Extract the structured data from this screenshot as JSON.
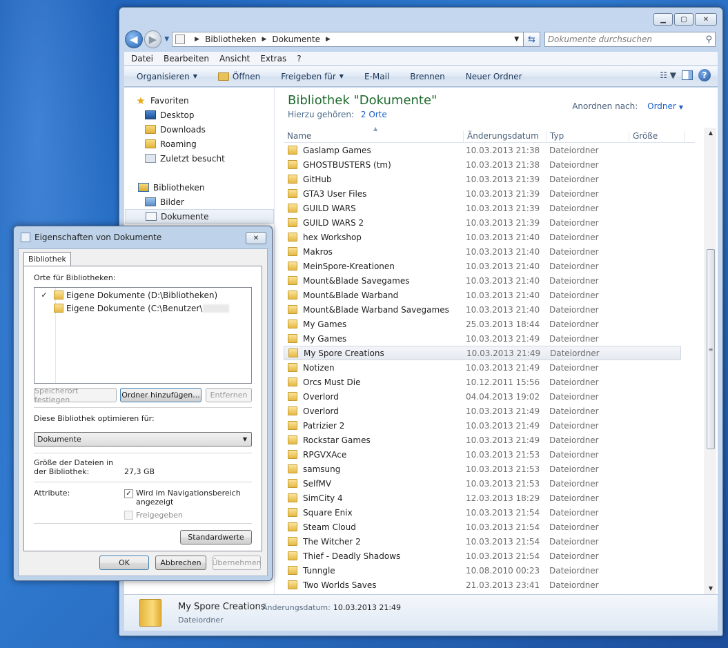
{
  "window": {
    "controls": {
      "minimize": "▁",
      "maximize": "▢",
      "close": "✕"
    },
    "breadcrumb": [
      "Bibliotheken",
      "Dokumente"
    ],
    "search_placeholder": "Dokumente durchsuchen",
    "menu": [
      "Datei",
      "Bearbeiten",
      "Ansicht",
      "Extras",
      "?"
    ],
    "toolbar": [
      "Organisieren",
      "Öffnen",
      "Freigeben für",
      "E-Mail",
      "Brennen",
      "Neuer Ordner"
    ]
  },
  "nav": {
    "favorites": "Favoriten",
    "fav_items": [
      "Desktop",
      "Downloads",
      "Roaming",
      "Zuletzt besucht"
    ],
    "libraries": "Bibliotheken",
    "lib_items": [
      "Bilder",
      "Dokumente"
    ]
  },
  "library": {
    "title": "Bibliothek \"Dokumente\"",
    "includes_label": "Hierzu gehören:",
    "includes_link": "2 Orte",
    "arrange_label": "Anordnen nach:",
    "arrange_value": "Ordner"
  },
  "columns": {
    "name": "Name",
    "date": "Änderungsdatum",
    "type": "Typ",
    "size": "Größe"
  },
  "files": [
    {
      "name": "Gaslamp Games",
      "date": "10.03.2013 21:38",
      "type": "Dateiordner"
    },
    {
      "name": "GHOSTBUSTERS (tm)",
      "date": "10.03.2013 21:38",
      "type": "Dateiordner"
    },
    {
      "name": "GitHub",
      "date": "10.03.2013 21:39",
      "type": "Dateiordner"
    },
    {
      "name": "GTA3 User Files",
      "date": "10.03.2013 21:39",
      "type": "Dateiordner"
    },
    {
      "name": "GUILD WARS",
      "date": "10.03.2013 21:39",
      "type": "Dateiordner"
    },
    {
      "name": "GUILD WARS 2",
      "date": "10.03.2013 21:39",
      "type": "Dateiordner"
    },
    {
      "name": "hex Workshop",
      "date": "10.03.2013 21:40",
      "type": "Dateiordner"
    },
    {
      "name": "Makros",
      "date": "10.03.2013 21:40",
      "type": "Dateiordner"
    },
    {
      "name": "MeinSpore-Kreationen",
      "date": "10.03.2013 21:40",
      "type": "Dateiordner"
    },
    {
      "name": "Mount&Blade Savegames",
      "date": "10.03.2013 21:40",
      "type": "Dateiordner"
    },
    {
      "name": "Mount&Blade Warband",
      "date": "10.03.2013 21:40",
      "type": "Dateiordner"
    },
    {
      "name": "Mount&Blade Warband Savegames",
      "date": "10.03.2013 21:40",
      "type": "Dateiordner"
    },
    {
      "name": "My Games",
      "date": "25.03.2013 18:44",
      "type": "Dateiordner"
    },
    {
      "name": "My Games",
      "date": "10.03.2013 21:49",
      "type": "Dateiordner"
    },
    {
      "name": "My Spore Creations",
      "date": "10.03.2013 21:49",
      "type": "Dateiordner"
    },
    {
      "name": "Notizen",
      "date": "10.03.2013 21:49",
      "type": "Dateiordner"
    },
    {
      "name": "Orcs Must Die",
      "date": "10.12.2011 15:56",
      "type": "Dateiordner"
    },
    {
      "name": "Overlord",
      "date": "04.04.2013 19:02",
      "type": "Dateiordner"
    },
    {
      "name": "Overlord",
      "date": "10.03.2013 21:49",
      "type": "Dateiordner"
    },
    {
      "name": "Patrizier 2",
      "date": "10.03.2013 21:49",
      "type": "Dateiordner"
    },
    {
      "name": "Rockstar Games",
      "date": "10.03.2013 21:49",
      "type": "Dateiordner"
    },
    {
      "name": "RPGVXAce",
      "date": "10.03.2013 21:53",
      "type": "Dateiordner"
    },
    {
      "name": "samsung",
      "date": "10.03.2013 21:53",
      "type": "Dateiordner"
    },
    {
      "name": "SelfMV",
      "date": "10.03.2013 21:53",
      "type": "Dateiordner"
    },
    {
      "name": "SimCity 4",
      "date": "12.03.2013 18:29",
      "type": "Dateiordner"
    },
    {
      "name": "Square Enix",
      "date": "10.03.2013 21:54",
      "type": "Dateiordner"
    },
    {
      "name": "Steam Cloud",
      "date": "10.03.2013 21:54",
      "type": "Dateiordner"
    },
    {
      "name": "The Witcher 2",
      "date": "10.03.2013 21:54",
      "type": "Dateiordner"
    },
    {
      "name": "Thief - Deadly Shadows",
      "date": "10.03.2013 21:54",
      "type": "Dateiordner"
    },
    {
      "name": "Tunngle",
      "date": "10.08.2010 00:23",
      "type": "Dateiordner"
    },
    {
      "name": "Two Worlds Saves",
      "date": "21.03.2013 23:41",
      "type": "Dateiordner"
    }
  ],
  "selected_index": 14,
  "details": {
    "name": "My Spore Creations",
    "date_label": "Änderungsdatum:",
    "date_value": "10.03.2013 21:49",
    "type": "Dateiordner"
  },
  "dialog": {
    "title": "Eigenschaften von Dokumente",
    "tab": "Bibliothek",
    "locations_label": "Orte für Bibliotheken:",
    "locations": [
      {
        "check": "✓",
        "path": "Eigene Dokumente (D:\\Bibliotheken)"
      },
      {
        "check": "",
        "path": "Eigene Dokumente (C:\\Benutzer\\"
      }
    ],
    "btn_set_location": "Speicherort festlegen",
    "btn_add_folder": "Ordner hinzufügen...",
    "btn_remove": "Entfernen",
    "optimize_label": "Diese Bibliothek optimieren für:",
    "optimize_value": "Dokumente",
    "size_label": "Größe der Dateien in der Bibliothek:",
    "size_value": "27,3 GB",
    "attributes_label": "Attribute:",
    "attr_nav": "Wird im Navigationsbereich angezeigt",
    "attr_nav_checked": "✓",
    "attr_shared": "Freigegeben",
    "btn_defaults": "Standardwerte",
    "btn_ok": "OK",
    "btn_cancel": "Abbrechen",
    "btn_apply": "Übernehmen"
  }
}
